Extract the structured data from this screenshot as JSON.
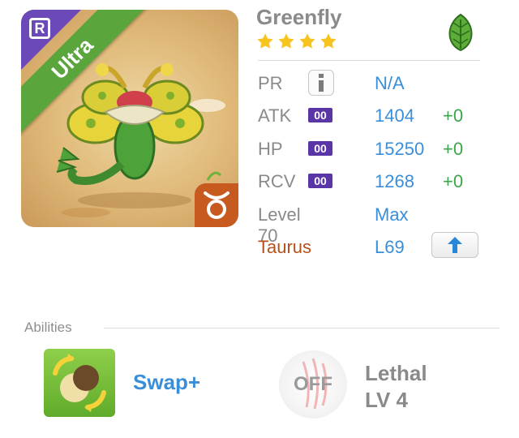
{
  "monster": {
    "name": "Greenfly",
    "rarity_letter": "R",
    "tier": "Ultra",
    "stars": 4
  },
  "stats": {
    "pr": {
      "label": "PR",
      "value": "N/A"
    },
    "atk": {
      "label": "ATK",
      "badge": "00",
      "value": "1404",
      "bonus": "+0"
    },
    "hp": {
      "label": "HP",
      "badge": "00",
      "value": "15250",
      "bonus": "+0"
    },
    "rcv": {
      "label": "RCV",
      "badge": "00",
      "value": "1268",
      "bonus": "+0"
    },
    "level": {
      "label": "Level 70",
      "value": "Max"
    },
    "zodiac": {
      "label": "Taurus",
      "value": "L69"
    }
  },
  "abilities": {
    "section_label": "Abilities",
    "skill": {
      "name": "Swap+"
    },
    "passive": {
      "state": "OFF",
      "name": "Lethal",
      "level": "LV 4"
    }
  },
  "colors": {
    "accent_blue": "#3a8ed8",
    "bonus_green": "#3aa64a",
    "zodiac_orange": "#b4501a",
    "tier_green": "#5aa53c",
    "badge_purple": "#5a35a6"
  },
  "icons": [
    "rarity-badge-icon",
    "taurus-icon",
    "leaf-element-icon",
    "star-icon",
    "info-icon",
    "arrow-up-icon",
    "swap-skill-icon",
    "lethal-claw-icon"
  ]
}
